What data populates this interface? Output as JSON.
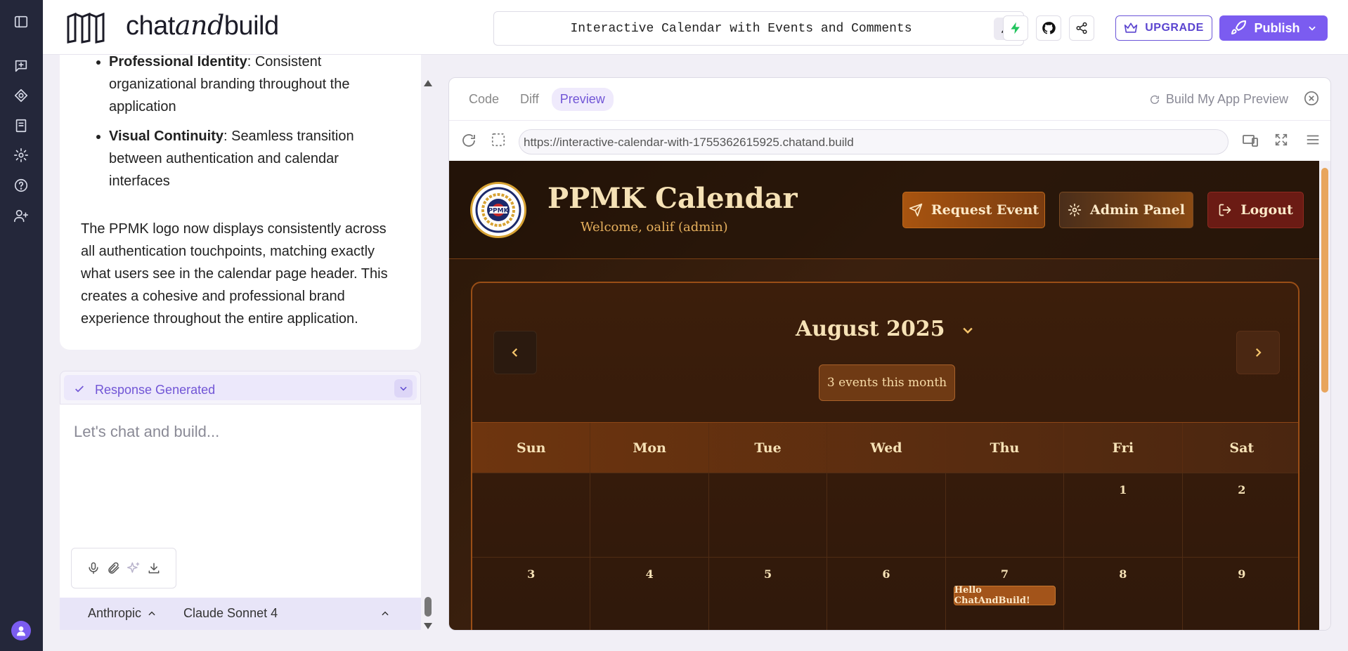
{
  "topbar": {
    "logo_prefix": "chat",
    "logo_italic": "and",
    "logo_suffix": "build",
    "project_title": "Interactive Calendar with Events and Comments",
    "upgrade_label": "UPGRADE",
    "publish_label": "Publish"
  },
  "chat": {
    "bullets": [
      {
        "bold": "Professional Identity",
        "text": ": Consistent organizational branding throughout the application"
      },
      {
        "bold": "Visual Continuity",
        "text": ": Seamless transition between authentication and calendar interfaces"
      }
    ],
    "paragraph": "The PPMK logo now displays consistently across all authentication touchpoints, matching exactly what users see in the calendar page header. This creates a cohesive and professional brand experience throughout the entire application.",
    "response_status": "Response Generated",
    "input_placeholder": "Let's chat and build...",
    "provider": "Anthropic",
    "model": "Claude Sonnet 4"
  },
  "preview": {
    "tabs": [
      "Code",
      "Diff",
      "Preview"
    ],
    "active_tab": "Preview",
    "build_label": "Build My App Preview",
    "url": "https://interactive-calendar-with-1755362615925.chatand.build"
  },
  "app": {
    "title": "PPMK Calendar",
    "welcome": "Welcome, oalif (admin)",
    "seal_text": "PPMK",
    "buttons": {
      "request": "Request Event",
      "admin": "Admin Panel",
      "logout": "Logout"
    },
    "month": "August 2025",
    "event_count": "3 events this month",
    "weekdays": [
      "Sun",
      "Mon",
      "Tue",
      "Wed",
      "Thu",
      "Fri",
      "Sat"
    ],
    "weeks": [
      [
        "",
        "",
        "",
        "",
        "",
        "1",
        "2"
      ],
      [
        "3",
        "4",
        "5",
        "6",
        "7",
        "8",
        "9"
      ]
    ],
    "event_day": "7",
    "event_label": "Hello ChatAndBuild!"
  },
  "colors": {
    "rail": "#24273a",
    "accent": "#7b5cf0",
    "app_bg": "#2a1709",
    "app_gold": "#f6e2b6"
  }
}
